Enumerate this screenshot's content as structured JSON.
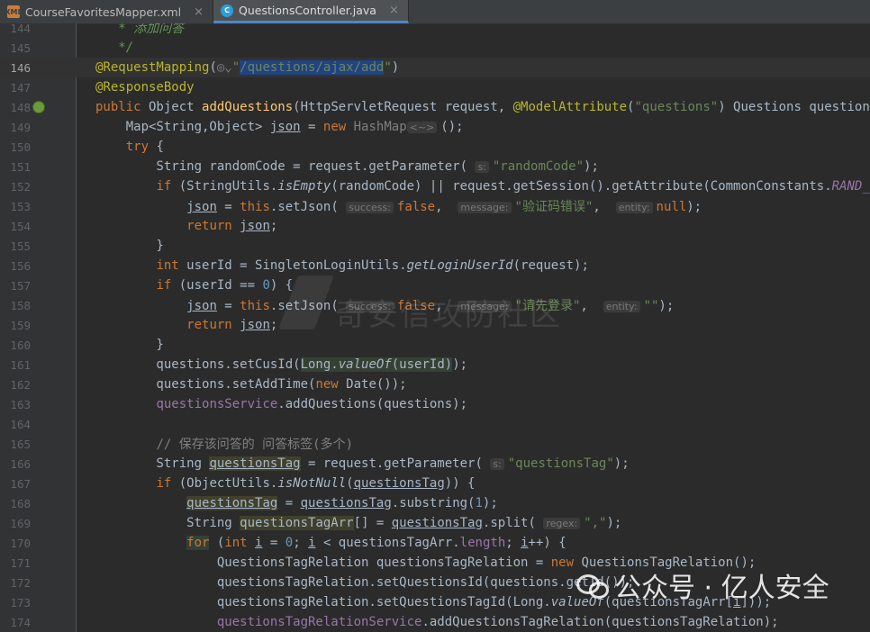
{
  "tabs": [
    {
      "label": "CourseFavoritesMapper.xml",
      "icon": "xml-file-icon"
    },
    {
      "label": "QuestionsController.java",
      "icon": "java-class-icon"
    }
  ],
  "watermark": "奇安信攻防社区",
  "wechat_label": "公众号 · 亿人安全",
  "lines": [
    {
      "n": "144",
      "html": "<span class=\"doc\">   * 添加问答</span>"
    },
    {
      "n": "145",
      "html": "<span class=\"doc\">   */</span>"
    },
    {
      "n": "146",
      "html": "<span class=\"ann\">@RequestMapping</span>(<span class=\"cmt\">◎⌄</span><span class=\"str\">\"<span class=\"sel\">/questions/ajax/add</span>\"</span>)",
      "current": true
    },
    {
      "n": "147",
      "html": "<span class=\"ann\">@ResponseBody</span>"
    },
    {
      "n": "148",
      "html": "<span class=\"kw\">public</span> Object <span class=\"fn\">addQuestions</span>(HttpServletRequest request, <span class=\"ann\">@ModelAttribute</span>(<span class=\"str\">\"questions\"</span>) Questions questions) {",
      "run": true
    },
    {
      "n": "149",
      "html": "    Map&lt;String,Object&gt; <span class=\"ul\">json</span> = <span class=\"kw\">new</span> <span class=\"cmt\">HashMap</span><span class=\"hint\">&lt;~&gt;</span>();"
    },
    {
      "n": "150",
      "html": "    <span class=\"kw\">try</span> {"
    },
    {
      "n": "151",
      "html": "        String randomCode = request.getParameter( <span class=\"hint\">s:</span><span class=\"str\">\"randomCode\"</span>);"
    },
    {
      "n": "152",
      "html": "        <span class=\"kw\">if</span> (StringUtils.<span class=\"static\">isEmpty</span>(randomCode) || request.getSession().getAttribute(CommonConstants.<span class=\"field static\">RAND_CODE</span>)"
    },
    {
      "n": "153",
      "html": "            <span class=\"ul\">json</span> = <span class=\"kw\">this</span>.setJson( <span class=\"hint\">success:</span><span class=\"kw\">false</span>,  <span class=\"hint\">message:</span><span class=\"str\">\"验证码错误\"</span>,  <span class=\"hint\">entity:</span><span class=\"kw\">null</span>);"
    },
    {
      "n": "154",
      "html": "            <span class=\"kw\">return</span> <span class=\"ul\">json</span>;"
    },
    {
      "n": "155",
      "html": "        }"
    },
    {
      "n": "156",
      "html": "        <span class=\"kw\">int</span> userId = SingletonLoginUtils.<span class=\"static\">getLoginUserId</span>(request);"
    },
    {
      "n": "157",
      "html": "        <span class=\"kw\">if</span> (userId == <span class=\"num\">0</span>) {"
    },
    {
      "n": "158",
      "html": "            <span class=\"ul\">json</span> = <span class=\"kw\">this</span>.setJson( <span class=\"hint\">success:</span><span class=\"kw\">false</span>,  <span class=\"hint\">message:</span><span class=\"str\">\"请先登录\"</span>,  <span class=\"hint\">entity:</span><span class=\"str\">\"\"</span>);"
    },
    {
      "n": "159",
      "html": "            <span class=\"kw\">return</span> <span class=\"ul\">json</span>;"
    },
    {
      "n": "160",
      "html": "        }"
    },
    {
      "n": "161",
      "html": "        questions.setCusId(<span class=\"hl\">Long.<span class=\"static\">valueOf</span>(userId)</span>);"
    },
    {
      "n": "162",
      "html": "        questions.setAddTime(<span class=\"kw\">new</span> Date());"
    },
    {
      "n": "163",
      "html": "        <span class=\"field\">questionsService</span>.addQuestions(questions);"
    },
    {
      "n": "164",
      "html": ""
    },
    {
      "n": "165",
      "html": "        <span class=\"cmt\">// 保存该问答的 问答标签(多个)</span>"
    },
    {
      "n": "166",
      "html": "        String <span class=\"ul var\">questionsTag</span> = request.getParameter( <span class=\"hint\">s:</span><span class=\"str\">\"questionsTag\"</span>);"
    },
    {
      "n": "167",
      "html": "        <span class=\"kw\">if</span> (ObjectUtils.<span class=\"static\">isNotNull</span>(<span class=\"ul\">questionsTag</span>)) {"
    },
    {
      "n": "168",
      "html": "            <span class=\"ul var\">questionsTag</span> = <span class=\"ul\">questionsTag</span>.substring(<span class=\"num\">1</span>);"
    },
    {
      "n": "169",
      "html": "            String <span class=\"var\">questionsTagArr</span>[] = <span class=\"ul\">questionsTag</span>.split( <span class=\"hint\">regex:</span><span class=\"str\">\",\"</span>);"
    },
    {
      "n": "170",
      "html": "            <span class=\"kw hl\">for</span> (<span class=\"kw\">int</span> <span class=\"ul\">i</span> = <span class=\"num\">0</span>; <span class=\"ul\">i</span> &lt; questionsTagArr.<span class=\"field\">length</span>; <span class=\"ul\">i</span>++) {"
    },
    {
      "n": "171",
      "html": "                QuestionsTagRelation questionsTagRelation = <span class=\"kw\">new</span> QuestionsTagRelation();"
    },
    {
      "n": "172",
      "html": "                questionsTagRelation.setQuestionsId(questions.getId());"
    },
    {
      "n": "173",
      "html": "                questionsTagRelation.setQuestionsTagId(Long.<span class=\"static\">valueOf</span>(questionsTagArr[<span class=\"ul\">i</span>]));"
    },
    {
      "n": "174",
      "html": "                <span class=\"field\">questionsTagRelationService</span>.addQuestionsTagRelation(questionsTagRelation);"
    }
  ]
}
